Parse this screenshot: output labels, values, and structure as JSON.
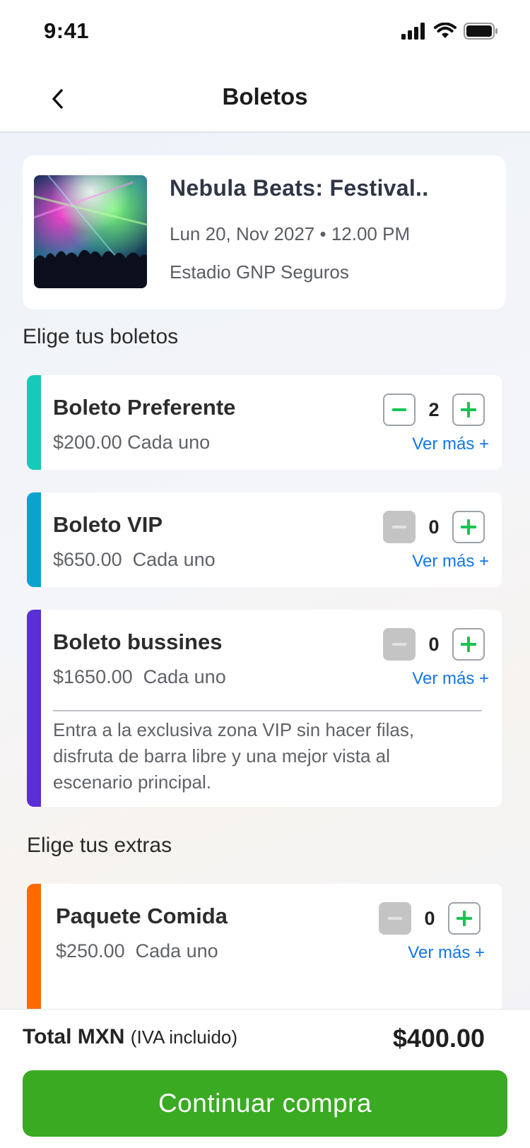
{
  "status_bar": {
    "time": "9:41"
  },
  "nav": {
    "title": "Boletos"
  },
  "event": {
    "title": "Nebula Beats: Festival..",
    "date": "Lun 20, Nov 2027 • 12.00 PM",
    "venue": "Estadio GNP Seguros"
  },
  "tickets_section": {
    "title": "Elige tus boletos"
  },
  "tickets": [
    {
      "name": "Boleto Preferente",
      "price": "$200.00 Cada uno",
      "quantity": "2",
      "ver_mas": "Ver más +",
      "accent": "#16c9b8",
      "minus_enabled": true
    },
    {
      "name": "Boleto VIP",
      "price": "$650.00  Cada uno",
      "quantity": "0",
      "ver_mas": "Ver más +",
      "accent": "#0aa3d0",
      "minus_enabled": false
    },
    {
      "name": "Boleto bussines",
      "price": "$1650.00  Cada uno",
      "quantity": "0",
      "ver_mas": "Ver más +",
      "accent": "#5a2fd6",
      "minus_enabled": false,
      "description": "Entra a la exclusiva zona VIP sin hacer filas, disfruta de barra libre y una mejor vista al escenario principal."
    }
  ],
  "extras_section": {
    "title": "Elige tus extras"
  },
  "extras": [
    {
      "name": "Paquete Comida",
      "price": "$250.00  Cada uno",
      "quantity": "0",
      "ver_mas": "Ver más +",
      "accent": "#ff6a00",
      "minus_enabled": false
    }
  ],
  "footer": {
    "total_label": "Total MXN",
    "total_iva": "(IVA incluido)",
    "total_amount": "$400.00",
    "continue_label": "Continuar compra"
  },
  "colors": {
    "primary_green": "#3aaa22",
    "plus_green": "#19c34f",
    "link_blue": "#1476e6"
  },
  "icons": [
    "signal-icon",
    "wifi-icon",
    "battery-icon",
    "back-chevron-icon",
    "minus-icon",
    "plus-icon"
  ]
}
